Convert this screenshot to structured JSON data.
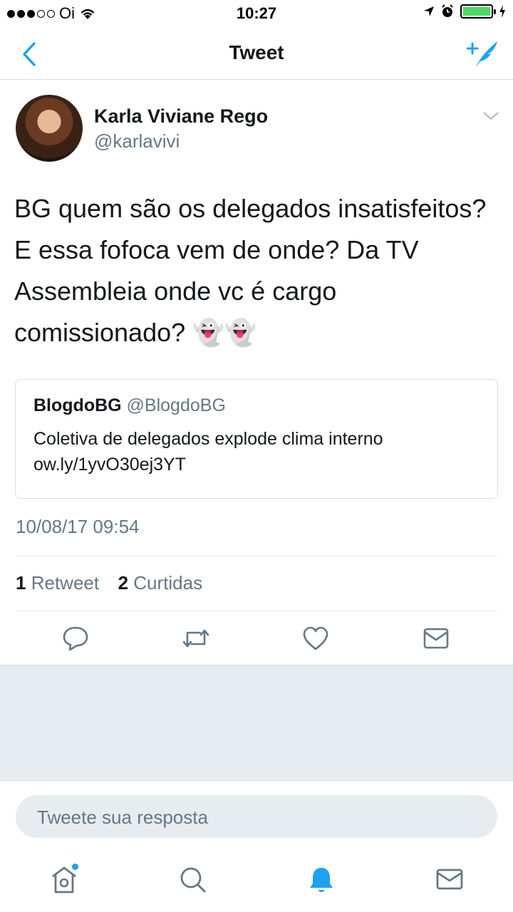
{
  "status_bar": {
    "carrier": "Oi",
    "time": "10:27"
  },
  "nav": {
    "title": "Tweet"
  },
  "tweet": {
    "author_name": "Karla Viviane Rego",
    "author_handle": "@karlavivi",
    "text": "BG quem são os delegados insatisfeitos? E essa fofoca vem de onde? Da TV Assembleia onde vc é cargo comissionado? 👻👻",
    "quoted": {
      "name": "BlogdoBG",
      "handle": "@BlogdoBG",
      "text": "Coletiva de delegados explode clima interno ow.ly/1yvO30ej3YT"
    },
    "timestamp": "10/08/17 09:54",
    "retweet_count": "1",
    "retweet_label": "Retweet",
    "likes_count": "2",
    "likes_label": "Curtidas"
  },
  "reply": {
    "placeholder": "Tweete sua resposta"
  },
  "colors": {
    "accent": "#1da1f2",
    "secondary_text": "#657786",
    "icon": "#657786"
  },
  "icons": [
    "back-arrow-icon",
    "compose-icon",
    "chevron-down-icon",
    "reply-icon",
    "retweet-icon",
    "like-icon",
    "dm-icon",
    "home-icon",
    "search-icon",
    "notifications-icon",
    "messages-icon"
  ]
}
